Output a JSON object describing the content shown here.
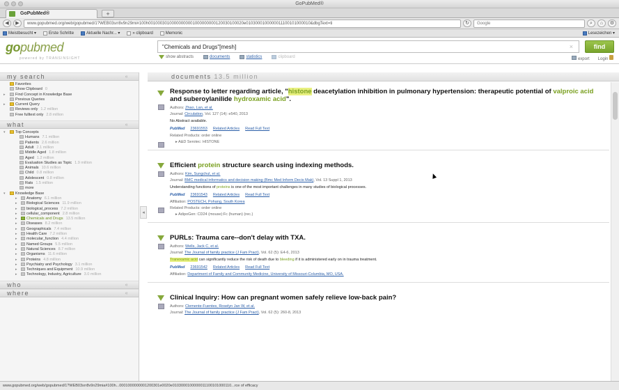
{
  "window": {
    "title": "GoPubMed®"
  },
  "tab": {
    "label": "GoPubMed®",
    "new_tab": "+"
  },
  "nav": {
    "url": "www.gopubmed.org/web/gopubmed/1?WEB03srr8v9n29mi#100h00100030100000000001000000000120030100020e0103000100000011100101000010&dbgText=ti",
    "search_engine": "Google"
  },
  "bookmarks": {
    "items": [
      "Meistbesucht ▾",
      "Erste Schritte",
      "Aktuelle Nachr... ▾",
      "» clipboard",
      "Memonic"
    ],
    "right": "Lesezeichen ▾"
  },
  "header": {
    "logo_a": "go",
    "logo_b": "pubmed",
    "logo_sub": "powered by TRANSINSIGHT",
    "query": "\"Chemicals and Drugs\"[mesh]",
    "clear": "×",
    "find_label": "find",
    "show_abstracts": "show abstracts",
    "documents": "documents",
    "statistics": "statistics",
    "clipboard": "clipboard",
    "export": "export",
    "login": "Login"
  },
  "sidebar": {
    "my_search_title": "my search",
    "my_search": [
      {
        "label": "Favorites",
        "count": ""
      },
      {
        "label": "Show Clipboard",
        "count": "0"
      },
      {
        "label": "Find Concept in Knowledge Base",
        "count": ""
      },
      {
        "label": "Previous Queries",
        "count": ""
      },
      {
        "label": "Current Query",
        "count": ""
      },
      {
        "label": "Reviews only",
        "count": "1.2 million"
      },
      {
        "label": "Free fulltext only",
        "count": "2.8 million"
      }
    ],
    "what_title": "what",
    "top_concepts_label": "Top Concepts",
    "top_concepts": [
      {
        "label": "Humans",
        "count": "7.1 million"
      },
      {
        "label": "Patients",
        "count": "2.6 million"
      },
      {
        "label": "Adult",
        "count": "2.1 million"
      },
      {
        "label": "Middle Aged",
        "count": "1.8 million"
      },
      {
        "label": "Aged",
        "count": "1.2 million"
      },
      {
        "label": "Evaluation Studies as Topic",
        "count": "1.9 million"
      },
      {
        "label": "Animals",
        "count": "10.6 million"
      },
      {
        "label": "Child",
        "count": "0.8 million"
      },
      {
        "label": "Adolescent",
        "count": "0.8 million"
      },
      {
        "label": "Rats",
        "count": "1.5 million"
      },
      {
        "label": "more",
        "count": ""
      }
    ],
    "kb_label": "Knowledge Base",
    "kb": [
      {
        "label": "Anatomy",
        "count": "6.1 million"
      },
      {
        "label": "Biological Sciences",
        "count": "11.9 million"
      },
      {
        "label": "biological_process",
        "count": "7.2 million"
      },
      {
        "label": "cellular_component",
        "count": "2.8 million"
      },
      {
        "label": "Chemicals and Drugs",
        "count": "13.5 million"
      },
      {
        "label": "Diseases",
        "count": "8.2 million"
      },
      {
        "label": "Geographicals",
        "count": "7.4 million"
      },
      {
        "label": "Health Care",
        "count": "7.2 million"
      },
      {
        "label": "molecular_function",
        "count": "4.4 million"
      },
      {
        "label": "Named Groups",
        "count": "5.5 million"
      },
      {
        "label": "Natural Sciences",
        "count": "8.7 million"
      },
      {
        "label": "Organisms",
        "count": "11.6 million"
      },
      {
        "label": "Proteins",
        "count": "4.8 million"
      },
      {
        "label": "Psychiatry and Psychology",
        "count": "3.1 million"
      },
      {
        "label": "Techniques and Equipment",
        "count": "10.9 million"
      },
      {
        "label": "Technology, Industry, Agriculture",
        "count": "3.0 million"
      }
    ],
    "who_title": "who",
    "where_title": "where"
  },
  "documents": {
    "label": "documents",
    "count": "13.5 million"
  },
  "articles": [
    {
      "title_pre": "Response to letter regarding article, \"",
      "t1": "histone",
      "title_mid1": " deacetylation inhibition in pulmonary hypertension: therapeutic potential of ",
      "t2": "valproic acid",
      "title_mid2": " and suberoylanilide ",
      "t3": "hydroxamic acid",
      "title_post": "\".",
      "authors": "Zhao, Lan, et al.",
      "journal_name": "Circulation",
      "journal_rest": ", Vol. 127 (14): e540, 2013",
      "abstract": "No Abstract available.",
      "pmid": "23691553",
      "related": "Related Articles",
      "full": "Read Full Text",
      "products": "Related Products: order online",
      "sub": "A&D Serotec: HISTONE"
    },
    {
      "title_pre": "Efficient ",
      "t1": "protein",
      "title_post": " structure search using indexing methods.",
      "authors": "Kim, Sungchul, et al.",
      "journal_name": "BMC medical informatics and decision making (Bmc Med Inform Decis Mak)",
      "journal_rest": ", Vol. 13 Suppl 1, 2013",
      "abs_pre": "Understanding functions of ",
      "abs_hl": "proteins",
      "abs_post": " is one of the most important challenges in many studies of biological processes.",
      "pmid": "23691543",
      "related": "Related Articles",
      "full": "Read Full Text",
      "affil_label": "Affiliation: ",
      "affil": "POSTECH, Pohang, South Korea",
      "products": "Related Products: order online",
      "sub": "AdipoGen: CD24 (mouse):Fc (human) (rec.)"
    },
    {
      "title": "PURLs: Trauma care--don't delay with TXA.",
      "authors": "Wells, Jack C, et al.",
      "journal_name": "The Journal of family practice (J Fam Pract)",
      "journal_rest": ", Vol. 62 (5): E4-6, 2013",
      "abs_hl": "Tranexamic acid",
      "abs_mid": " can significantly reduce the risk of death due to ",
      "abs_hl2": "bleeding",
      "abs_post": " if it is administered early on in trauma treatment.",
      "pmid": "23691542",
      "related": "Related Articles",
      "full": "Read Full Text",
      "affil_label": "Affiliation: ",
      "affil": "Department of Family and Community Medicine, University of Missouri-Columbia, MO, USA."
    },
    {
      "title": "Clinical Inquiry: How can pregnant women safely relieve low-back pain?",
      "authors": "Clemente-Fuentes, Roselyn Jan W, et al.",
      "journal_name": "The Journal of family practice (J Fam Pract)",
      "journal_rest": ", Vol. 62 (5): 260-8, 2013"
    }
  ],
  "labels": {
    "authors": "Authors: ",
    "journal": "Journal: "
  },
  "status": {
    "text": "www.gopubmed.org/web/gopubmed/1?WEB03srr8v9n29mia#100h...0001000000001200301e0020e0103000100000011100101000110...rce of efficacy"
  }
}
